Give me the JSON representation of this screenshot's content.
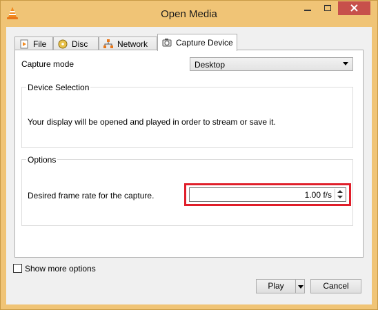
{
  "window": {
    "title": "Open Media"
  },
  "tabs": [
    {
      "label": "File",
      "icon": "file-icon"
    },
    {
      "label": "Disc",
      "icon": "disc-icon"
    },
    {
      "label": "Network",
      "icon": "network-icon"
    },
    {
      "label": "Capture Device",
      "icon": "capture-device-icon",
      "active": true
    }
  ],
  "capture": {
    "mode_label": "Capture mode",
    "mode_value": "Desktop"
  },
  "device_selection": {
    "title": "Device Selection",
    "message": "Your display will be opened and played in order to stream or save it."
  },
  "options": {
    "title": "Options",
    "frame_rate_label": "Desired frame rate for the capture.",
    "frame_rate_value": "1.00 f/s"
  },
  "footer": {
    "show_more_label": "Show more options",
    "play_label": "Play",
    "cancel_label": "Cancel"
  },
  "colors": {
    "titlebar": "#f0c476",
    "close_button": "#c7504b",
    "highlight_box": "#e01e2a"
  }
}
